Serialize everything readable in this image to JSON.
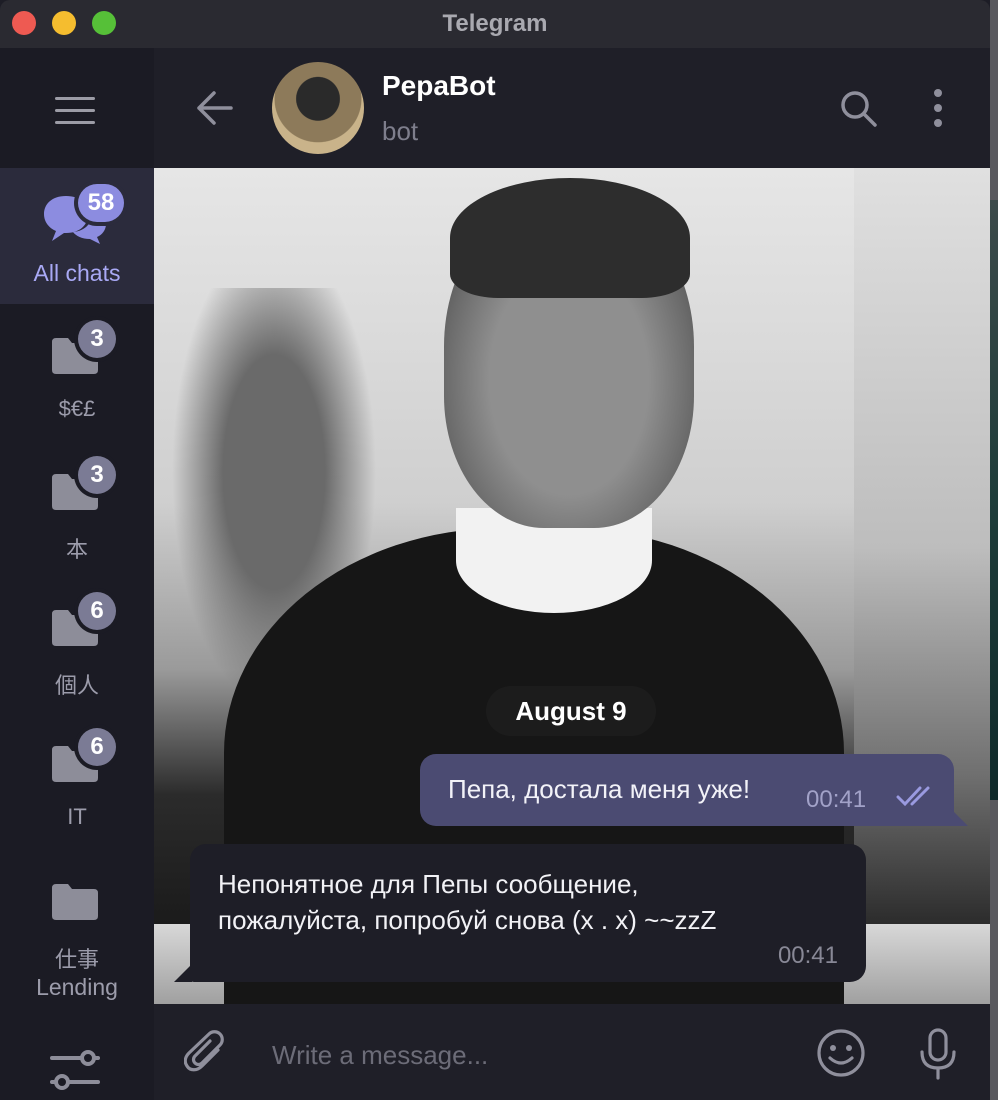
{
  "window": {
    "title": "Telegram"
  },
  "sidebar": {
    "folders": [
      {
        "label": "All chats",
        "badge": "58",
        "icon": "chat-bubbles-icon",
        "active": true
      },
      {
        "label": "$€£",
        "badge": "3",
        "icon": "folder-icon"
      },
      {
        "label": "本",
        "badge": "3",
        "icon": "folder-icon"
      },
      {
        "label": "個人",
        "badge": "6",
        "icon": "folder-icon"
      },
      {
        "label": "IT",
        "badge": "6",
        "icon": "folder-icon"
      },
      {
        "label_line1": "仕事",
        "label_line2": "Lending",
        "icon": "folder-icon"
      }
    ],
    "accent": "#8c8ce0"
  },
  "header": {
    "name": "PepaBot",
    "status": "bot"
  },
  "chat": {
    "date": "August 9",
    "outgoing": {
      "text": "Пепа, достала меня уже!",
      "time": "00:41",
      "bubble_color": "#4b4b72"
    },
    "incoming": {
      "line1": "Непонятное для Пепы сообщение,",
      "line2": "пожалуйста, попробуй снова (x . x) ~~zzZ",
      "time": "00:41"
    }
  },
  "composer": {
    "placeholder": "Write a message..."
  }
}
